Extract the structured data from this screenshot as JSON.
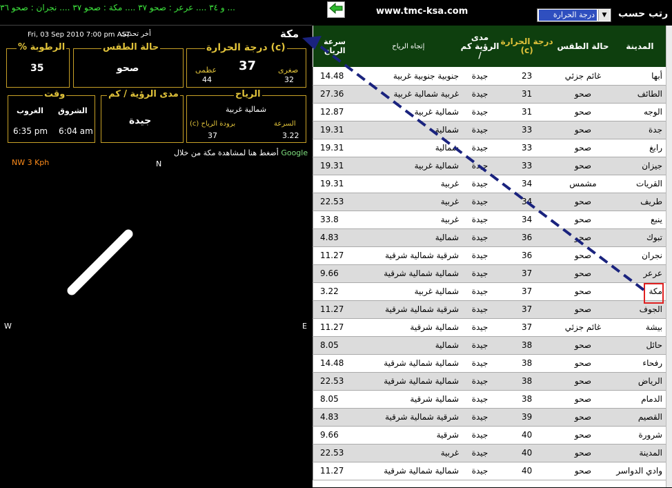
{
  "ticker": "... و ٣٤  ....  عرعر : صحو ٣٧  ....  مكة : صحو ٣٧  ....  نجران : صحو ٣٦",
  "site_name": "www.tmc-ksa.com",
  "sort": {
    "label": "رتب حسب",
    "selected": "درجة الحرارة"
  },
  "detail": {
    "city": "مكة",
    "update_label": "أخر تحديث",
    "update_time": "Fri, 03 Sep 2010 7:00 pm AST",
    "temperature_title": "درجة الحرارة (c)",
    "temp_current": "37",
    "min_label": "صغرى",
    "min_value": "32",
    "max_label": "عظمى",
    "max_value": "44",
    "weather_title": "حالة الطقس",
    "weather_value": "صحو",
    "humidity_title": "% الرطوبة",
    "humidity_value": "35",
    "wind_title": "الرياح",
    "wind_direction": "شمالية غربية",
    "wind_speed_label": "السرعة",
    "wind_speed_value": "3.22",
    "wind_chill_label": "(c) برودة  الرياح",
    "wind_chill_value": "37",
    "visibility_title": "مدى الرؤية / كم",
    "visibility_value": "جيدة",
    "time_title": "وقت",
    "sunrise_label": "الشروق",
    "sunrise_value": "6:04 am",
    "sunset_label": "الغروب",
    "sunset_value": "6:35 pm",
    "google_prefix": "Google",
    "google_text": "أضغط هنا لمشاهدة مكة من خلال",
    "compass_n": "N",
    "compass_w": "W",
    "compass_e": "E",
    "wind_readout": "NW  3 Kph"
  },
  "table": {
    "headers": {
      "city": "المدينة",
      "condition": "حالة الطقس",
      "temperature": "درجة الحرارة (c)",
      "visibility": "مدى الرؤية كم /",
      "wind_direction": "إتجاه الرياح",
      "wind_speed": "سرعة الرياح"
    },
    "rows": [
      {
        "city": "أبها",
        "condition": "غائم جزئي",
        "temp": "23",
        "vis": "جيدة",
        "dir": "جنوبية جنوبية غربية",
        "speed": "14.48"
      },
      {
        "city": "الطائف",
        "condition": "صحو",
        "temp": "31",
        "vis": "جيدة",
        "dir": "غربية شمالية غربية",
        "speed": "27.36"
      },
      {
        "city": "الوجه",
        "condition": "صحو",
        "temp": "31",
        "vis": "جيدة",
        "dir": "شمالية غربية",
        "speed": "12.87"
      },
      {
        "city": "جدة",
        "condition": "صحو",
        "temp": "33",
        "vis": "جيدة",
        "dir": "شمالية",
        "speed": "19.31"
      },
      {
        "city": "رابغ",
        "condition": "صحو",
        "temp": "33",
        "vis": "جيدة",
        "dir": "شمالية",
        "speed": "19.31"
      },
      {
        "city": "جيزان",
        "condition": "صحو",
        "temp": "33",
        "vis": "جيدة",
        "dir": "شمالية غربية",
        "speed": "19.31"
      },
      {
        "city": "القريات",
        "condition": "مشمس",
        "temp": "34",
        "vis": "جيدة",
        "dir": "غربية",
        "speed": "19.31"
      },
      {
        "city": "طريف",
        "condition": "صحو",
        "temp": "34",
        "vis": "جيدة",
        "dir": "غربية",
        "speed": "22.53"
      },
      {
        "city": "ينبع",
        "condition": "صحو",
        "temp": "34",
        "vis": "جيدة",
        "dir": "غربية",
        "speed": "33.8"
      },
      {
        "city": "تبوك",
        "condition": "صحو",
        "temp": "36",
        "vis": "جيدة",
        "dir": "شمالية",
        "speed": "4.83"
      },
      {
        "city": "نجران",
        "condition": "صحو",
        "temp": "36",
        "vis": "جيدة",
        "dir": "شرقية شمالية شرقية",
        "speed": "11.27"
      },
      {
        "city": "عرعر",
        "condition": "صحو",
        "temp": "37",
        "vis": "جيدة",
        "dir": "شمالية شمالية شرقية",
        "speed": "9.66"
      },
      {
        "city": "مكة",
        "condition": "صحو",
        "temp": "37",
        "vis": "جيدة",
        "dir": "شمالية غربية",
        "speed": "3.22"
      },
      {
        "city": "الجوف",
        "condition": "صحو",
        "temp": "37",
        "vis": "جيدة",
        "dir": "شرقية شمالية شرقية",
        "speed": "11.27"
      },
      {
        "city": "بيشة",
        "condition": "غائم جزئي",
        "temp": "37",
        "vis": "جيدة",
        "dir": "شمالية شرقية",
        "speed": "11.27"
      },
      {
        "city": "حائل",
        "condition": "صحو",
        "temp": "38",
        "vis": "جيدة",
        "dir": "شمالية",
        "speed": "8.05"
      },
      {
        "city": "رفحاء",
        "condition": "صحو",
        "temp": "38",
        "vis": "جيدة",
        "dir": "شمالية شمالية شرقية",
        "speed": "14.48"
      },
      {
        "city": "الرياض",
        "condition": "صحو",
        "temp": "38",
        "vis": "جيدة",
        "dir": "شمالية شمالية شرقية",
        "speed": "22.53"
      },
      {
        "city": "الدمام",
        "condition": "صحو",
        "temp": "38",
        "vis": "جيدة",
        "dir": "شمالية شرقية",
        "speed": "8.05"
      },
      {
        "city": "القصيم",
        "condition": "صحو",
        "temp": "39",
        "vis": "جيدة",
        "dir": "شرقية شمالية شرقية",
        "speed": "4.83"
      },
      {
        "city": "شرورة",
        "condition": "صحو",
        "temp": "40",
        "vis": "جيدة",
        "dir": "شرقية",
        "speed": "9.66"
      },
      {
        "city": "المدينة",
        "condition": "صحو",
        "temp": "40",
        "vis": "جيدة",
        "dir": "غربية",
        "speed": "22.53"
      },
      {
        "city": "وادي الدواسر",
        "condition": "صحو",
        "temp": "40",
        "vis": "جيدة",
        "dir": "شمالية شمالية شرقية",
        "speed": "11.27"
      }
    ]
  },
  "colors": {
    "header_bg": "#0e3f0e",
    "gold": "#e0c23a",
    "ticker_green": "#3ee63e",
    "arrow_blue": "#1a237e",
    "highlight_red": "#e02020"
  }
}
